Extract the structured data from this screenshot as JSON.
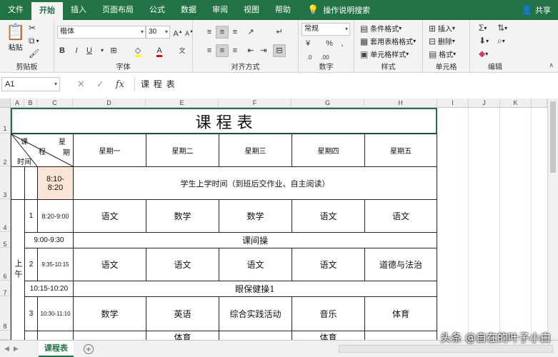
{
  "tabs": [
    "文件",
    "开始",
    "插入",
    "页面布局",
    "公式",
    "数据",
    "审阅",
    "视图",
    "帮助"
  ],
  "active_tab": "开始",
  "tell_me": "操作说明搜索",
  "share": "共享",
  "ribbon": {
    "clipboard": {
      "paste": "粘贴",
      "label": "剪贴板"
    },
    "font": {
      "name": "楷体",
      "size": "30",
      "label": "字体",
      "bold": "B",
      "italic": "I",
      "underline": "U"
    },
    "alignment": {
      "label": "对齐方式"
    },
    "number": {
      "format": "常规",
      "label": "数字",
      "percent": "%"
    },
    "styles": {
      "conditional": "条件格式",
      "table": "套用表格格式",
      "cell": "单元格样式",
      "label": "样式"
    },
    "cells": {
      "insert": "插入",
      "delete": "删除",
      "format": "格式",
      "label": "单元格"
    },
    "editing": {
      "label": "编辑"
    }
  },
  "formula_bar": {
    "name_box": "A1",
    "value": "课    程    表"
  },
  "columns": [
    "A",
    "B",
    "C",
    "D",
    "E",
    "F",
    "G",
    "H",
    "I",
    "J",
    "K"
  ],
  "rows": [
    "1",
    "2",
    "3",
    "4",
    "5",
    "6",
    "7",
    "8"
  ],
  "timetable": {
    "title": "课    程    表",
    "header_diag": {
      "top_left": "课",
      "mid_left": "程",
      "bottom_left": "时间",
      "top_right": "星",
      "bottom_right": "期"
    },
    "days": [
      "星期一",
      "星期二",
      "星期三",
      "星期四",
      "星期五"
    ],
    "row3": {
      "time": "8:10-\n8:20",
      "text": "学生上学时间（到班后交作业、自主阅读）"
    },
    "row4": {
      "num": "1",
      "time": "8:20-9:00",
      "subjects": [
        "语文",
        "数学",
        "数学",
        "语文",
        "语文"
      ]
    },
    "row5": {
      "time": "9:00-9:30",
      "text": "课间操"
    },
    "row6": {
      "num": "2",
      "time": "9:35-10:15",
      "subjects": [
        "语文",
        "语文",
        "语文",
        "语文",
        "道德与法治"
      ]
    },
    "row7": {
      "time": "10:15-10:20",
      "text": "眼保健操1"
    },
    "row8": {
      "num": "3",
      "time": "10:30-11:10",
      "subjects": [
        "数学",
        "英语",
        "综合实践活动",
        "音乐",
        "体育"
      ]
    },
    "row9": {
      "subjects": [
        "",
        "体育",
        "",
        "体育",
        ""
      ]
    },
    "period_label": "上午"
  },
  "sheet_tab": "课程表",
  "watermark": "头条 @自在的叶子小白"
}
